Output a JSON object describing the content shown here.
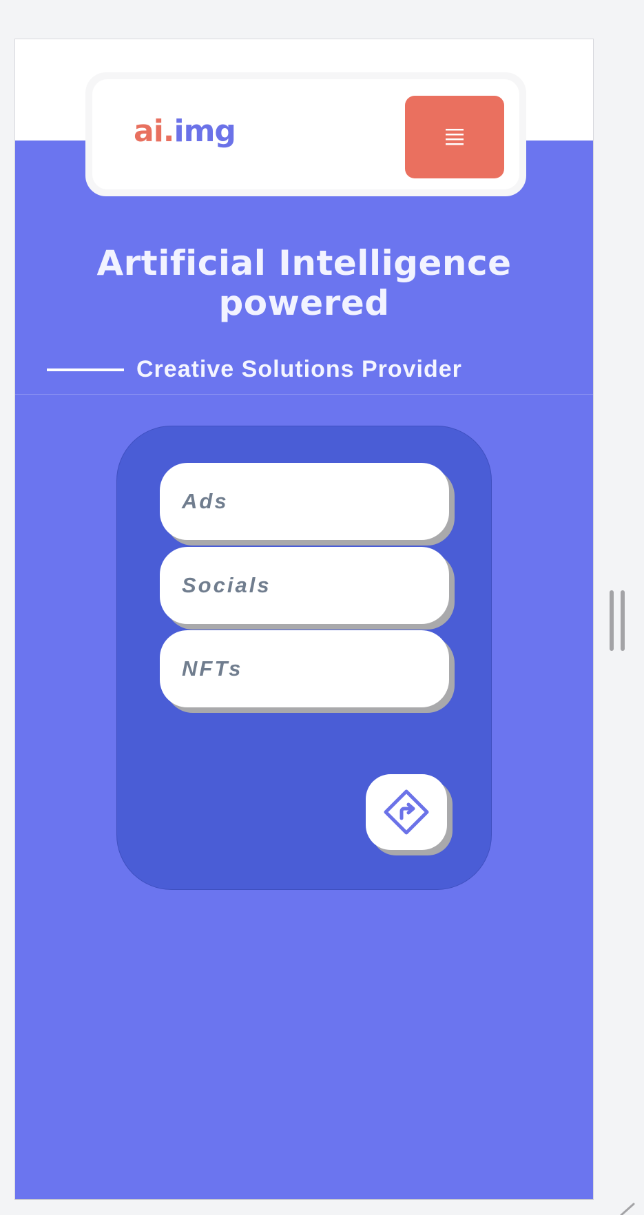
{
  "header": {
    "logo_part1": "ai.",
    "logo_part2": "img",
    "menu_icon": "hamburger-menu-icon"
  },
  "hero": {
    "title": "Artificial Intelligence powered",
    "subtitle": "Creative Solutions Provider"
  },
  "options": {
    "items": [
      {
        "label": "Ads"
      },
      {
        "label": "Socials"
      },
      {
        "label": "NFTs"
      }
    ]
  },
  "go_button": {
    "icon": "directions-sign-icon"
  },
  "colors": {
    "page_background": "#6b75ef",
    "panel_background": "#4a5dd6",
    "menu_button": "#ea705f",
    "logo_accent": "#e8705f",
    "logo_main": "#6b72e8"
  }
}
